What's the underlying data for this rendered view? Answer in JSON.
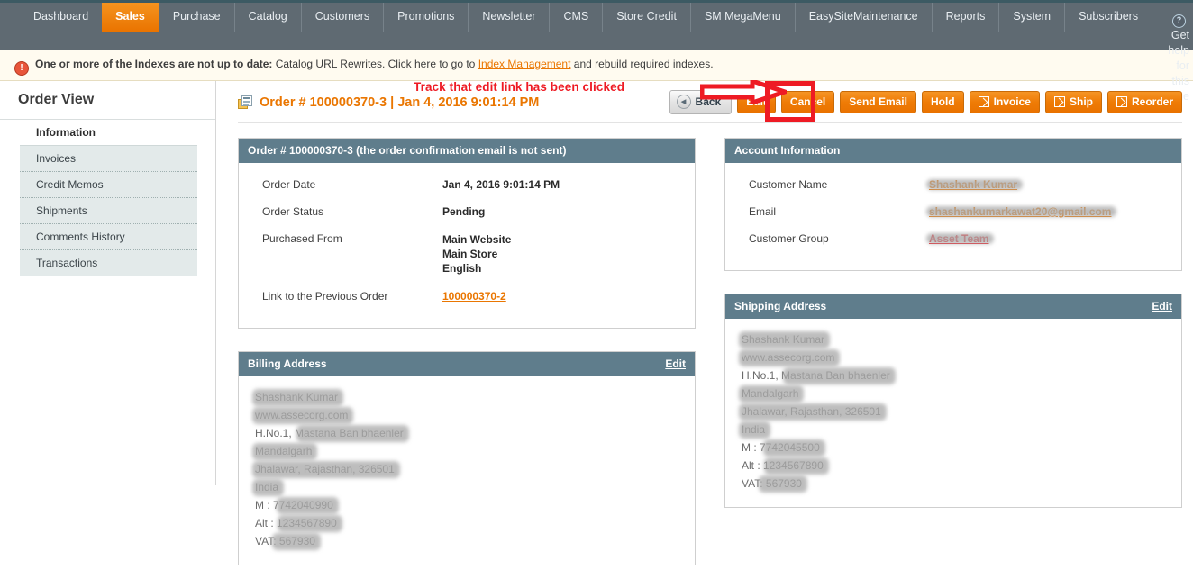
{
  "topnav": {
    "items": [
      {
        "label": "Dashboard",
        "active": false
      },
      {
        "label": "Sales",
        "active": true
      },
      {
        "label": "Purchase",
        "active": false
      },
      {
        "label": "Catalog",
        "active": false
      },
      {
        "label": "Customers",
        "active": false
      },
      {
        "label": "Promotions",
        "active": false
      },
      {
        "label": "Newsletter",
        "active": false
      },
      {
        "label": "CMS",
        "active": false
      },
      {
        "label": "Store Credit",
        "active": false
      },
      {
        "label": "SM MegaMenu",
        "active": false
      },
      {
        "label": "EasySiteMaintenance",
        "active": false
      },
      {
        "label": "Reports",
        "active": false
      },
      {
        "label": "System",
        "active": false
      },
      {
        "label": "Subscribers",
        "active": false
      }
    ],
    "help_label": "Get help for this page",
    "help_icon": "question-mark-circle-icon",
    "active_color": "#ea7400",
    "bg_color": "#5f6a72"
  },
  "notice": {
    "icon": "warning-circle-icon",
    "bold_part": "One or more of the Indexes are not up to date:",
    "text_part": " Catalog URL Rewrites. Click here to go to ",
    "link": "Index Management",
    "text_end": " and rebuild required indexes.",
    "bg_color": "#fffbf0"
  },
  "sidebar": {
    "title": "Order View",
    "items": [
      {
        "label": "Information",
        "active": true
      },
      {
        "label": "Invoices",
        "active": false
      },
      {
        "label": "Credit Memos",
        "active": false
      },
      {
        "label": "Shipments",
        "active": false
      },
      {
        "label": "Comments History",
        "active": false
      },
      {
        "label": "Transactions",
        "active": false
      }
    ]
  },
  "page_head": {
    "icon": "order-documents-icon",
    "title": "Order # 100000370-3 | Jan 4, 2016 9:01:14 PM",
    "buttons": [
      {
        "label": "Back",
        "style": "grey",
        "icon": "back-arrow-icon"
      },
      {
        "label": "Edit",
        "style": "orange",
        "icon": null
      },
      {
        "label": "Cancel",
        "style": "orange",
        "icon": null
      },
      {
        "label": "Send Email",
        "style": "orange",
        "icon": null
      },
      {
        "label": "Hold",
        "style": "orange",
        "icon": null
      },
      {
        "label": "Invoice",
        "style": "orange",
        "icon": "external-link-icon"
      },
      {
        "label": "Ship",
        "style": "orange",
        "icon": "external-link-icon"
      },
      {
        "label": "Reorder",
        "style": "orange",
        "icon": "external-link-icon"
      }
    ]
  },
  "annotation": {
    "text": "Track that edit link has been clicked",
    "color": "#ee1b24",
    "arrow": "right-arrow-annotation",
    "highlight_target": "Edit"
  },
  "order_panel": {
    "title": "Order # 100000370-3 (the order confirmation email is not sent)",
    "rows": [
      {
        "label": "Order Date",
        "value": "Jan 4, 2016 9:01:14 PM"
      },
      {
        "label": "Order Status",
        "value": "Pending"
      },
      {
        "label": "Purchased From",
        "value": "Main Website\nMain Store\nEnglish"
      },
      {
        "label": "Link to the Previous Order",
        "value": "100000370-2",
        "is_link": true
      }
    ]
  },
  "account_panel": {
    "title": "Account Information",
    "rows": [
      {
        "label": "Customer Name",
        "value": "Shashank Kumar",
        "redacted": true,
        "is_link": true
      },
      {
        "label": "Email",
        "value": "shashankumarkawat20@gmail.com",
        "redacted": true,
        "is_link": true
      },
      {
        "label": "Customer Group",
        "value": "Asset Team",
        "redacted": true,
        "red": true
      }
    ]
  },
  "billing_panel": {
    "title": "Billing Address",
    "edit_label": "Edit",
    "lines": [
      "Shashank Kumar",
      "www.assecorg.com",
      "H.No.1, Mastana Ban bhaenler",
      "Mandalgarh",
      "Jhalawar, Rajasthan, 326501",
      "India",
      "M : 7742040990",
      "Alt : 1234567890",
      "VAT: 567930"
    ]
  },
  "shipping_panel": {
    "title": "Shipping Address",
    "edit_label": "Edit",
    "lines": [
      "Shashank Kumar",
      "www.assecorg.com",
      "H.No.1, Mastana Ban bhaenler",
      "Mandalgarh",
      "Jhalawar, Rajasthan, 326501",
      "India",
      "M : 7742045500",
      "Alt : 1234567890",
      "VAT: 567930"
    ]
  }
}
